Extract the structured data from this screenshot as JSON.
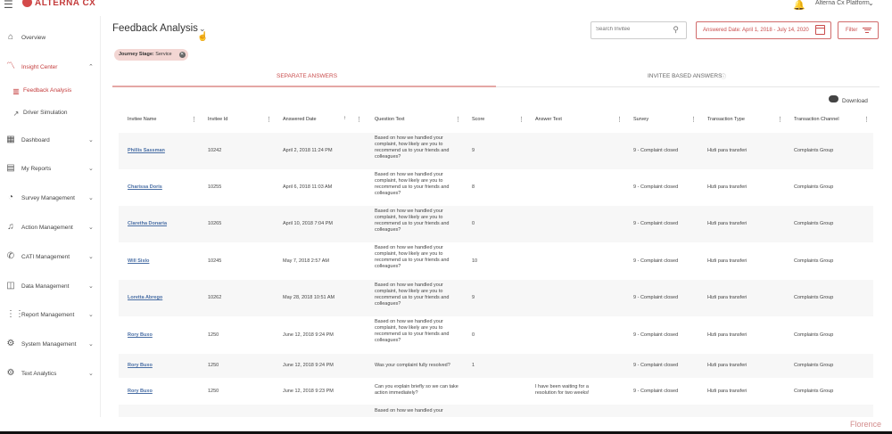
{
  "header": {
    "logo_text": "ALTERNA CX",
    "platform": "Alterna Cx Platform"
  },
  "sidebar": {
    "items": [
      {
        "label": "Overview",
        "icon": "home-icon"
      },
      {
        "label": "Insight Center",
        "icon": "chart-icon"
      },
      {
        "label": "Dashboard",
        "icon": "dashboard-icon"
      },
      {
        "label": "My Reports",
        "icon": "report-icon"
      },
      {
        "label": "Survey Management",
        "icon": "survey-icon"
      },
      {
        "label": "Action Management",
        "icon": "bell-icon"
      },
      {
        "label": "CATI Management",
        "icon": "phone-icon"
      },
      {
        "label": "Data Management",
        "icon": "data-icon"
      },
      {
        "label": "Report Management",
        "icon": "grid-icon"
      },
      {
        "label": "System Management",
        "icon": "gear-icon"
      },
      {
        "label": "Text Analytics",
        "icon": "gear-icon"
      }
    ],
    "sub_items": [
      {
        "label": "Feedback Analysis"
      },
      {
        "label": "Driver Simulation"
      }
    ]
  },
  "main": {
    "title": "Feedback Analysis",
    "search_placeholder": "Search Invitee",
    "date_range": "Answered Date: April 1, 2018 - July 14, 2020",
    "filter_label": "Filter",
    "chip_label": "Journey Stage:",
    "chip_value": "Service",
    "tabs": [
      "SEPARATE ANSWERS",
      "INVITEE BASED ANSWERS"
    ],
    "download_label": "Download"
  },
  "table": {
    "columns": [
      "Invitee Name",
      "Invitee Id",
      "Answered Date",
      "Question Text",
      "Score",
      "Answer Text",
      "Survey",
      "Transaction Type",
      "Transaction Channel"
    ],
    "rows": [
      {
        "name": "Phillis Sassman",
        "id": "10242",
        "date": "April 2, 2018 11:24 PM",
        "q": "Based on how we handled your complaint, how likely are you to recommend us to your friends and colleagues?",
        "score": "9",
        "answer": "",
        "survey": "9 - Complaint closed",
        "type": "Hizli para transferi",
        "channel": "Complaints Group"
      },
      {
        "name": "Charissa Doris",
        "id": "10255",
        "date": "April 6, 2018 11:03 AM",
        "q": "Based on how we handled your complaint, how likely are you to recommend us to your friends and colleagues?",
        "score": "8",
        "answer": "",
        "survey": "9 - Complaint closed",
        "type": "Hizli para transferi",
        "channel": "Complaints Group"
      },
      {
        "name": "Claretha Donaria",
        "id": "10265",
        "date": "April 10, 2018 7:04 PM",
        "q": "Based on how we handled your complaint, how likely are you to recommend us to your friends and colleagues?",
        "score": "0",
        "answer": "",
        "survey": "9 - Complaint closed",
        "type": "Hizli para transferi",
        "channel": "Complaints Group"
      },
      {
        "name": "Will Sislo",
        "id": "10245",
        "date": "May 7, 2018 2:57 AM",
        "q": "Based on how we handled your complaint, how likely are you to recommend us to your friends and colleagues?",
        "score": "10",
        "answer": "",
        "survey": "9 - Complaint closed",
        "type": "Hizli para transferi",
        "channel": "Complaints Group"
      },
      {
        "name": "Loretta Abrego",
        "id": "10262",
        "date": "May 28, 2018 10:51 AM",
        "q": "Based on how we handled your complaint, how likely are you to recommend us to your friends and colleagues?",
        "score": "9",
        "answer": "",
        "survey": "9 - Complaint closed",
        "type": "Hizli para transferi",
        "channel": "Complaints Group"
      },
      {
        "name": "Rory Buxo",
        "id": "1250",
        "date": "June 12, 2018 9:24 PM",
        "q": "Based on how we handled your complaint, how likely are you to recommend us to your friends and colleagues?",
        "score": "0",
        "answer": "",
        "survey": "9 - Complaint closed",
        "type": "Hizli para transferi",
        "channel": "Complaints Group"
      },
      {
        "name": "Rory Buxo",
        "id": "1250",
        "date": "June 12, 2018 9:24 PM",
        "q": "Was your complaint fully resolved?",
        "score": "1",
        "answer": "",
        "survey": "9 - Complaint closed",
        "type": "Hizli para transferi",
        "channel": "Complaints Group"
      },
      {
        "name": "Rory Buxo",
        "id": "1250",
        "date": "June 12, 2018 9:23 PM",
        "q": "Can you explain briefly so we can take action immediately?",
        "score": "",
        "answer": "I have been waiting for a resolution for two weeks!",
        "survey": "9 - Complaint closed",
        "type": "Hizli para transferi",
        "channel": "Complaints Group"
      },
      {
        "name": "",
        "id": "",
        "date": "",
        "q": "Based on how we handled your",
        "score": "",
        "answer": "",
        "survey": "",
        "type": "",
        "channel": ""
      }
    ]
  },
  "footer": {
    "watermark": "Florence"
  },
  "colors": {
    "accent": "#c43c3c",
    "link": "#4a6fa5",
    "chip_bg": "#f3d6d3"
  }
}
